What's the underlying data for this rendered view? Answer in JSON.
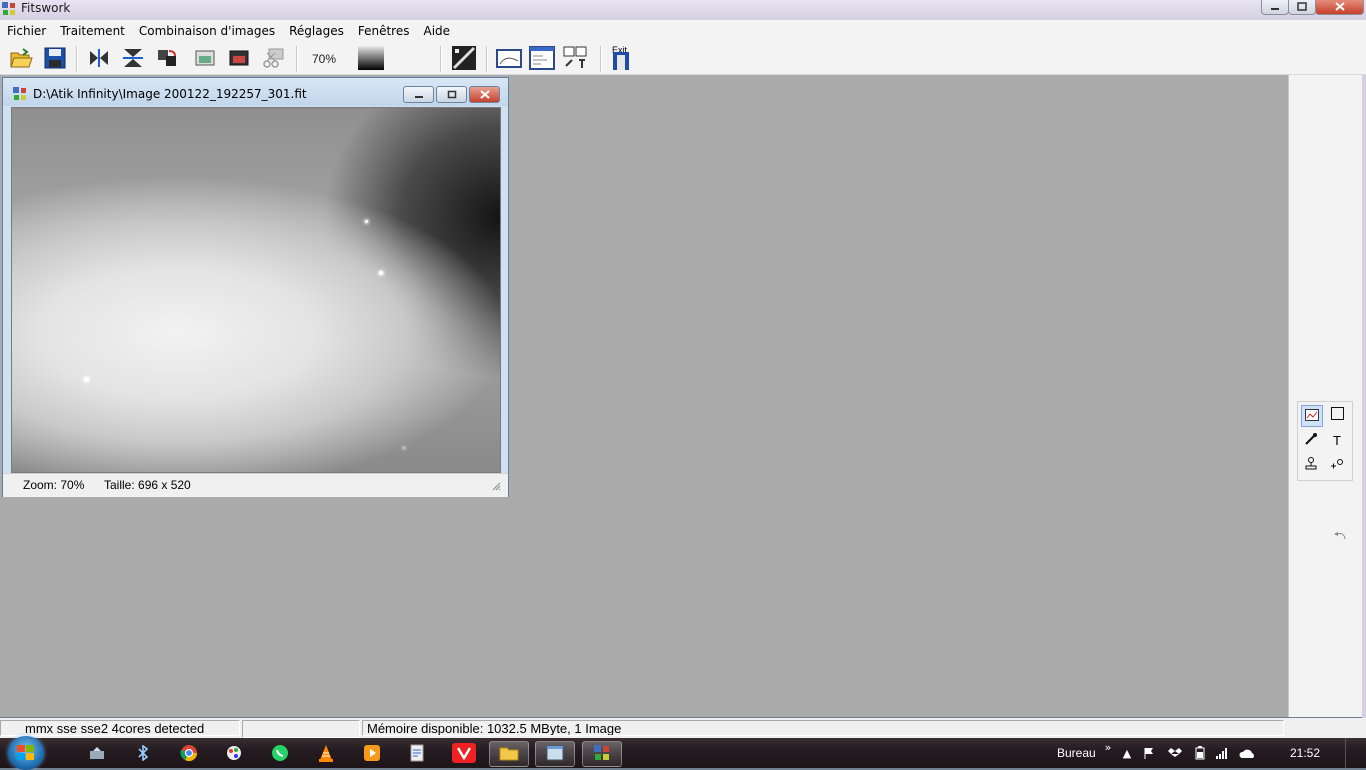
{
  "app": {
    "title": "Fitswork"
  },
  "menu": {
    "items": [
      "Fichier",
      "Traitement",
      "Combinaison d'images",
      "Réglages",
      "Fenêtres",
      "Aide"
    ]
  },
  "toolbar": {
    "buttons": [
      {
        "icon": "open-folder-icon"
      },
      {
        "icon": "save-icon"
      },
      {
        "icon": "flip-horizontal-icon"
      },
      {
        "icon": "flip-vertical-icon"
      },
      {
        "icon": "rotate-icon"
      },
      {
        "icon": "copy-image-icon"
      },
      {
        "icon": "paste-image-icon"
      },
      {
        "icon": "cut-image-icon"
      },
      {
        "icon": "histogram-icon"
      },
      {
        "icon": "image-window-icon"
      },
      {
        "icon": "image-list-icon"
      },
      {
        "icon": "align-icon"
      },
      {
        "icon": "exit-icon"
      }
    ],
    "zoom_label": "70%",
    "exit_label": "Exit"
  },
  "image_window": {
    "title": "D:\\Atik Infinity\\Image 200122_192257_301.fit",
    "zoom": "Zoom: 70%",
    "size": "Taille: 696 x 520"
  },
  "tools": {
    "items": [
      {
        "icon": "image-tool-icon",
        "selected": true
      },
      {
        "icon": "rectangle-select-icon"
      },
      {
        "icon": "pipette-icon"
      },
      {
        "icon": "text-tool-icon",
        "label": "T"
      },
      {
        "icon": "stamp-icon"
      },
      {
        "icon": "star-marker-icon"
      }
    ],
    "undo_icon": "undo-icon"
  },
  "status": {
    "cpu": "mmx sse sse2  4cores detected",
    "middle": "",
    "memory": "Mémoire disponible: 1032.5 MByte, 1 Image"
  },
  "taskbar": {
    "apps": [
      "network-icon",
      "bluetooth-icon",
      "chrome-icon",
      "paint-icon",
      "whatsapp-icon",
      "vlc-icon",
      "media-player-icon",
      "document-icon",
      "vivaldi-icon",
      "explorer-icon",
      "window-icon",
      "fitswork-icon"
    ],
    "bureau": "Bureau",
    "time": "21:52"
  }
}
